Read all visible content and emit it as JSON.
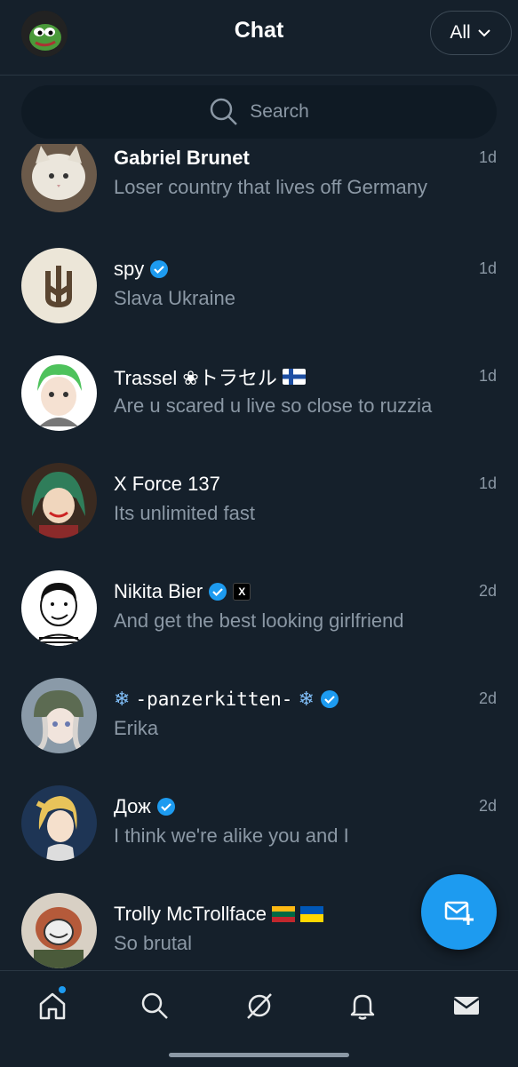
{
  "header": {
    "title": "Chat",
    "filter_label": "All"
  },
  "search": {
    "placeholder": "Search"
  },
  "chats": [
    {
      "name": "Gabriel Brunet",
      "preview": "Loser country that lives off Germany",
      "time": "1d",
      "verified": false
    },
    {
      "name": "spy",
      "preview": "Slava Ukraine",
      "time": "1d",
      "verified": true
    },
    {
      "name": "Trassel ❀トラセル",
      "preview": "Are u scared u live so close to ruzzia",
      "time": "1d",
      "verified": false
    },
    {
      "name": "X Force 137",
      "preview": "Its unlimited fast",
      "time": "1d",
      "verified": false
    },
    {
      "name": "Nikita Bier",
      "preview": "And get the best looking girlfriend",
      "time": "2d",
      "verified": true,
      "x_badge": "X"
    },
    {
      "name": "-panzerkitten-",
      "preview": "Erika",
      "time": "2d",
      "verified": true
    },
    {
      "name": "Дож",
      "preview": "I think we're alike you and I",
      "time": "2d",
      "verified": true
    },
    {
      "name": "Trolly McTrollface",
      "preview": "So brutal",
      "time": "",
      "verified": false
    }
  ],
  "icons": {
    "search": "search-icon",
    "chevron": "chevron-down-icon",
    "verified": "verified-badge-icon",
    "compose": "new-message-icon",
    "home": "home-icon",
    "explore": "search-icon",
    "grok": "grok-icon",
    "notifications": "bell-icon",
    "messages": "mail-icon"
  },
  "colors": {
    "background": "#15202b",
    "accent": "#1d9bf0",
    "muted": "#8b98a5"
  }
}
